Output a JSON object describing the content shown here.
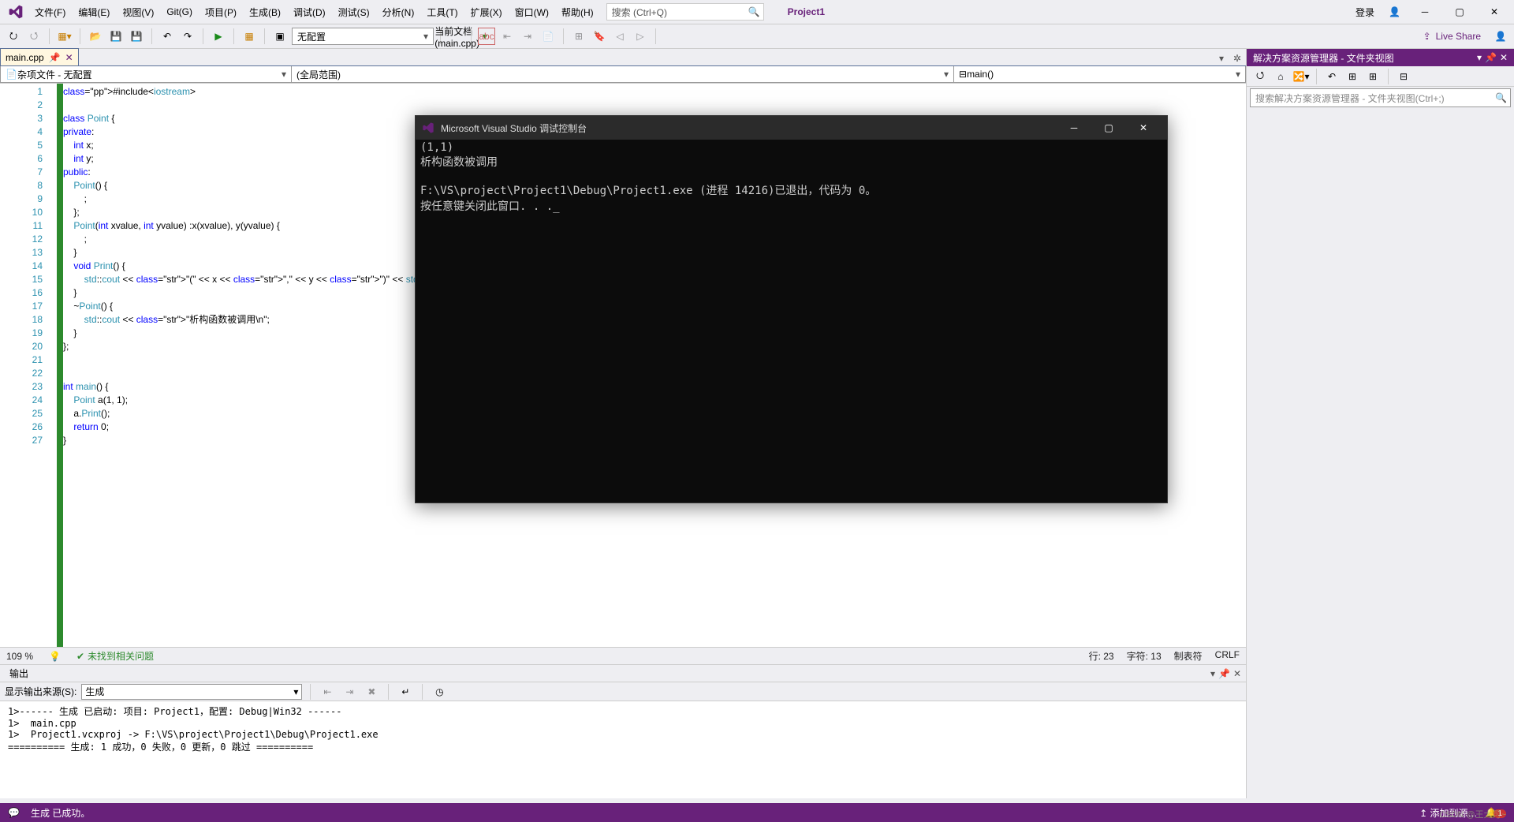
{
  "menu": {
    "file": "文件(F)",
    "edit": "编辑(E)",
    "view": "视图(V)",
    "git": "Git(G)",
    "project": "项目(P)",
    "build": "生成(B)",
    "debug": "调试(D)",
    "test": "测试(S)",
    "analyze": "分析(N)",
    "tools": "工具(T)",
    "ext": "扩展(X)",
    "window": "窗口(W)",
    "help": "帮助(H)"
  },
  "search": {
    "placeholder": "搜索 (Ctrl+Q)"
  },
  "project_name": "Project1",
  "signin": "登录",
  "toolbar": {
    "config": "无配置",
    "run_target": "当前文档(main.cpp)",
    "liveshare": "Live Share"
  },
  "tab": {
    "name": "main.cpp"
  },
  "nav": {
    "left": "杂项文件 - 无配置",
    "mid": "(全局范围)",
    "right": "main()"
  },
  "code_lines": [
    "#include<iostream>",
    "",
    "class Point {",
    "private:",
    "    int x;",
    "    int y;",
    "public:",
    "    Point() {",
    "        ;",
    "    };",
    "    Point(int xvalue, int yvalue) :x(xvalue), y(yvalue) {",
    "        ;",
    "    }",
    "    void Print() {",
    "        std::cout << \"(\" << x << \",\" << y << \")\" << std::endl;",
    "    }",
    "    ~Point() {",
    "        std::cout << \"析构函数被调用\\n\";",
    "    }",
    "};",
    "",
    "",
    "int main() {",
    "    Point a(1, 1);",
    "    a.Print();",
    "    return 0;",
    "}"
  ],
  "editor_status": {
    "zoom": "109 %",
    "noissue": "未找到相关问题",
    "line": "行: 23",
    "col": "字符: 13",
    "tabs": "制表符",
    "crlf": "CRLF"
  },
  "output": {
    "title": "输出",
    "src_label": "显示输出来源(S):",
    "src": "生成",
    "lines": [
      "1>------ 生成 已启动: 项目: Project1，配置: Debug|Win32 ------",
      "1>  main.cpp",
      "1>  Project1.vcxproj -> F:\\VS\\project\\Project1\\Debug\\Project1.exe",
      "========== 生成: 1 成功，0 失败，0 更新，0 跳过 =========="
    ]
  },
  "solution": {
    "title": "解决方案资源管理器 - 文件夹视图",
    "search_placeholder": "搜索解决方案资源管理器 - 文件夹视图(Ctrl+;)"
  },
  "status": {
    "msg": "生成 已成功。",
    "repo": "添加到源…",
    "notif": "1"
  },
  "console": {
    "title": "Microsoft Visual Studio 调试控制台",
    "lines": [
      "(1,1)",
      "析构函数被调用",
      "",
      "F:\\VS\\project\\Project1\\Debug\\Project1.exe (进程 14216)已退出，代码为 0。",
      "按任意键关闭此窗口. . ._"
    ]
  },
  "watermark": "CSDN @王大可~"
}
